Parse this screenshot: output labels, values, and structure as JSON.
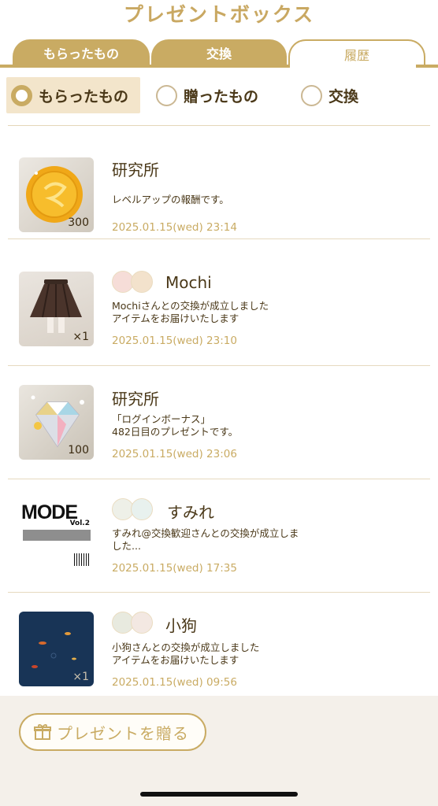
{
  "header": {
    "title": "プレゼントボックス"
  },
  "tabs": [
    {
      "label": "もらったもの"
    },
    {
      "label": "交換"
    },
    {
      "label": "履歴"
    }
  ],
  "filters": [
    {
      "label": "もらったもの",
      "selected": true
    },
    {
      "label": "贈ったもの",
      "selected": false
    },
    {
      "label": "交換",
      "selected": false
    }
  ],
  "items": [
    {
      "title": "研究所",
      "desc1": "レベルアップの報酬です。",
      "desc2": "",
      "date": "2025.01.15(wed) 23:14",
      "count": "300"
    },
    {
      "title": "Mochi",
      "desc1": "Mochiさんとの交換が成立しました",
      "desc2": "アイテムをお届けいたします",
      "date": "2025.01.15(wed) 23:10",
      "count": "×1"
    },
    {
      "title": "研究所",
      "desc1": "「ログインボーナス」",
      "desc2": "482日目のプレゼントです。",
      "date": "2025.01.15(wed) 23:06",
      "count": "100"
    },
    {
      "title": "すみれ",
      "desc1": "すみれ@交換歓迎さんとの交換が成立しま",
      "desc2": "した...",
      "date": "2025.01.15(wed) 17:35",
      "count": "",
      "thumb_text": "MODE",
      "thumb_sub": "Vol.2"
    },
    {
      "title": "小狗",
      "desc1": "小狗さんとの交換が成立しました",
      "desc2": "アイテムをお届けいたします",
      "date": "2025.01.15(wed) 09:56",
      "count": "×1"
    }
  ],
  "footer": {
    "send_label": "プレゼントを贈る",
    "send_icon": "gift-icon"
  },
  "colors": {
    "accent": "#c9ab63",
    "text": "#4a3818",
    "selected_bg": "#f3e5cb",
    "footer_bg": "#f4f0ea"
  }
}
